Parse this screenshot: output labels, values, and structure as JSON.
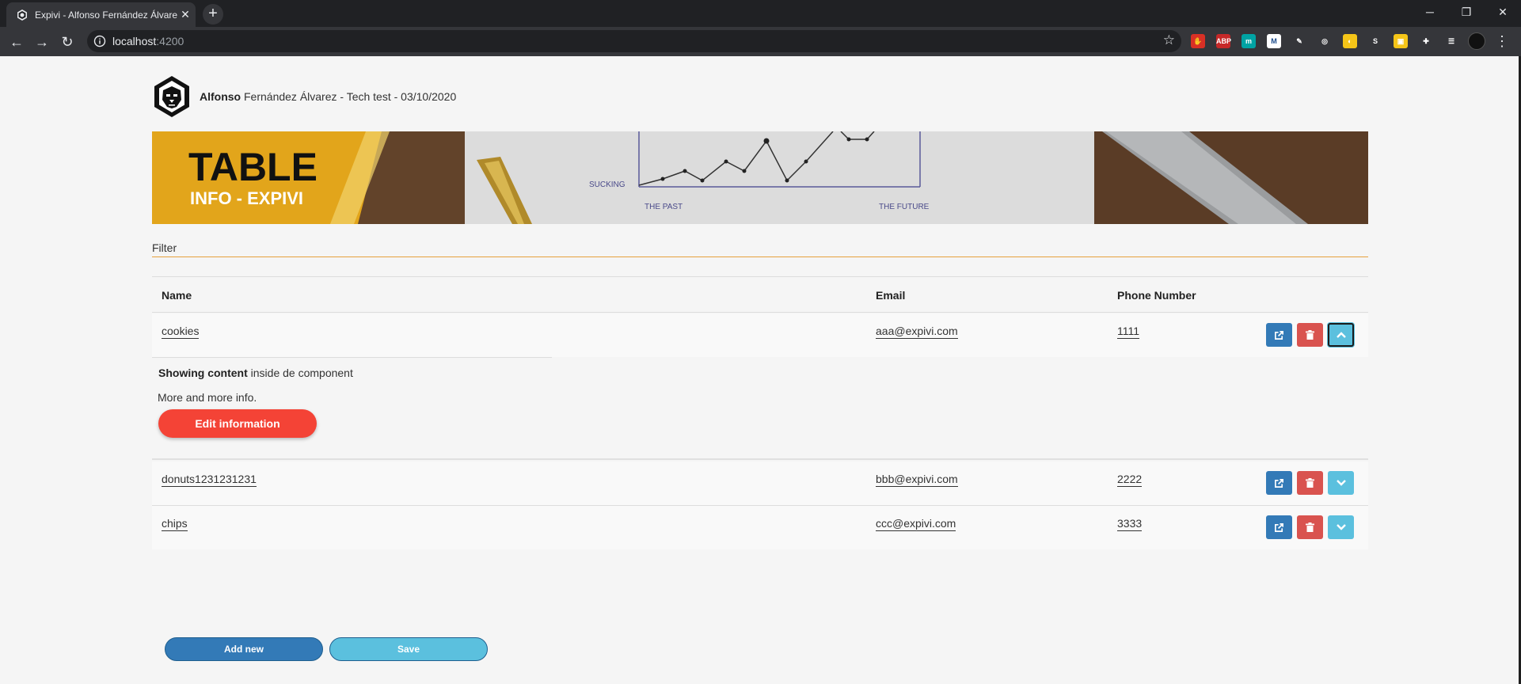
{
  "browser": {
    "tab_title": "Expivi - Alfonso Fernández Álvarez",
    "tab_close": "✕",
    "new_tab": "+",
    "url_host": "localhost",
    "url_port": ":4200",
    "window_controls": [
      "─",
      "❐",
      "✕"
    ],
    "extensions": [
      {
        "icon": "stop-hand-icon",
        "label": "✋",
        "color": "#d93025"
      },
      {
        "icon": "adblock-plus-icon",
        "label": "ABP",
        "color": "#c62828"
      },
      {
        "icon": "m-extension-icon",
        "label": "m",
        "color": "#00a3a3"
      },
      {
        "icon": "mw-extension-icon",
        "label": "M",
        "color": "#ffffff"
      },
      {
        "icon": "pen-extension-icon",
        "label": "✎",
        "color": "#35363a"
      },
      {
        "icon": "target-extension-icon",
        "label": "◎",
        "color": "#35363a"
      },
      {
        "icon": "moon-extension-icon",
        "label": "◐",
        "color": "#f5c518"
      },
      {
        "icon": "s-extension-icon",
        "label": "S",
        "color": "#35363a"
      },
      {
        "icon": "flag-extension-icon",
        "label": "▣",
        "color": "#f5c518"
      },
      {
        "icon": "puzzle-extensions-icon",
        "label": "✚",
        "color": "#35363a"
      },
      {
        "icon": "reading-list-icon",
        "label": "☰",
        "color": "#35363a"
      }
    ]
  },
  "header": {
    "first_name": "Alfonso",
    "rest": " Fernández Álvarez - Tech test - 03/10/2020"
  },
  "banner": {
    "title": "TABLE",
    "subtitle": "INFO - EXPIVI",
    "chart_left_label": "SUCKING",
    "chart_x_left": "THE PAST",
    "chart_x_right": "THE FUTURE"
  },
  "filter": {
    "placeholder": "Filter"
  },
  "table": {
    "columns": [
      "Name",
      "Email",
      "Phone Number"
    ],
    "rows": [
      {
        "name": "cookies",
        "email": "aaa@expivi.com",
        "phone": "1111",
        "expanded": true
      },
      {
        "name": "donuts1231231231",
        "email": "bbb@expivi.com",
        "phone": "2222",
        "expanded": false
      },
      {
        "name": "chips",
        "email": "ccc@expivi.com",
        "phone": "3333",
        "expanded": false
      }
    ]
  },
  "expanded": {
    "bold": "Showing content",
    "rest": " inside de component",
    "line2": "More and more info.",
    "edit_button": "Edit information"
  },
  "actions": {
    "add_new": "Add new",
    "save": "Save"
  },
  "colors": {
    "accent_filter": "#e6a23c",
    "btn_blue": "#337ab7",
    "btn_red": "#d9534f",
    "btn_cyan": "#5bc0de",
    "edit_red": "#f44336"
  }
}
